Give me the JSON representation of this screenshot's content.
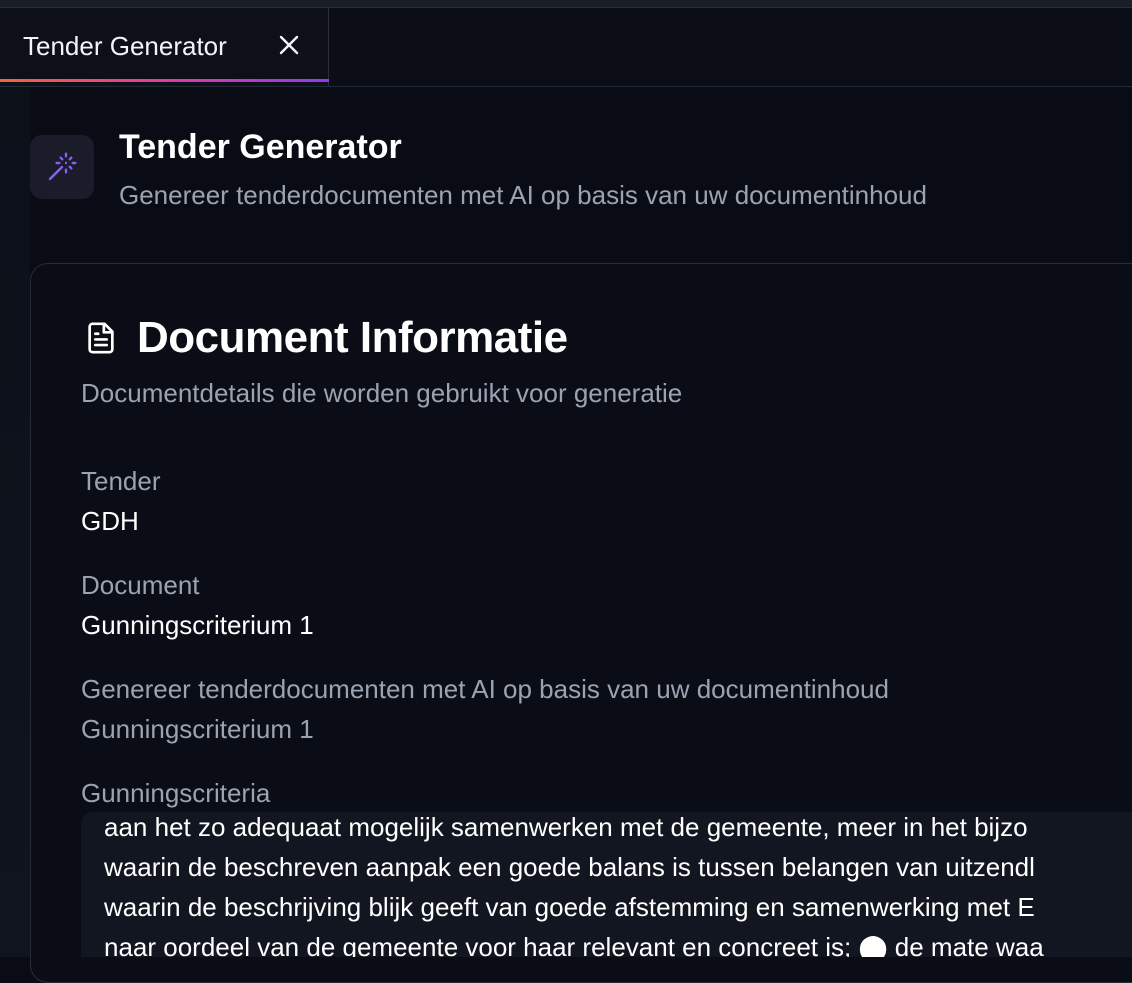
{
  "tab": {
    "label": "Tender Generator",
    "close_icon": "close-icon"
  },
  "header": {
    "icon": "magic-wand-icon",
    "title": "Tender Generator",
    "subtitle": "Genereer tenderdocumenten met AI op basis van uw documentinhoud"
  },
  "card": {
    "icon": "document-icon",
    "title": "Document Informatie",
    "subtitle": "Documentdetails die worden gebruikt voor generatie",
    "fields": [
      {
        "label": "Tender",
        "value": "GDH"
      },
      {
        "label": "Document",
        "value": "Gunningscriterium 1"
      },
      {
        "label": "Genereer tenderdocumenten met AI op basis van uw documentinhoud",
        "value": "Gunningscriterium 1"
      }
    ],
    "criteria": {
      "label": "Gunningscriteria",
      "lines": [
        "aan het zo adequaat mogelijk samenwerken met de gemeente, meer in het bijzo",
        "waarin de beschreven aanpak een goede balans is tussen belangen van uitzendl",
        "waarin de beschrijving blijk geeft van goede afstemming en samenwerking met E",
        "naar oordeel van de gemeente voor haar relevant en concreet is; ⬤ de mate waa"
      ]
    }
  },
  "colors": {
    "background": "#090c15",
    "tab_gradient_start": "#f0643c",
    "tab_gradient_end": "#8b3cf0",
    "icon_accent": "#8b5cf6",
    "muted_text": "#9aa3b2"
  }
}
